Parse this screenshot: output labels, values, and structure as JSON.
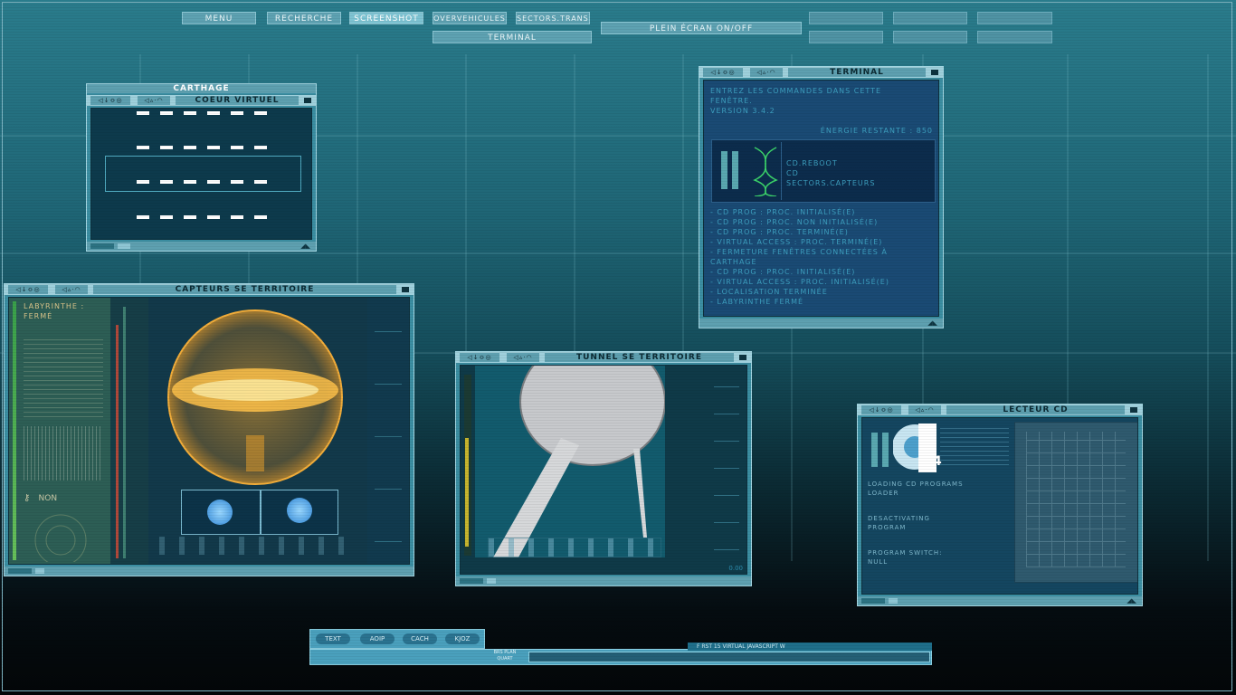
{
  "nav": {
    "menu": "MENU",
    "recherche": "RECHERCHE",
    "screenshot": "SCREENSHOT",
    "overvehicules": "OVERVEHICULES",
    "sectors": "SECTORS.TRANSP",
    "terminal": "TERMINAL",
    "fullscreen": "PLEIN ÉCRAN ON/OFF"
  },
  "carthage": {
    "title": "CARTHAGE",
    "subtitle": "COEUR VIRTUEL"
  },
  "capteurs": {
    "title": "CAPTEURS SE TERRITOIRE",
    "status_label": "LABYRINTHE :",
    "status_value": "FERMÉ",
    "key_label": "NON"
  },
  "tunnel": {
    "title": "TUNNEL SE TERRITOIRE",
    "counter": "0.00"
  },
  "terminal": {
    "title": "TERMINAL",
    "intro": [
      "ENTREZ LES COMMANDES DANS CETTE",
      "FENÊTRE.",
      "VERSION 3.4.2"
    ],
    "energy": "ÉNERGIE RESTANTE : 850",
    "commands": [
      "CD.REBOOT",
      "CD",
      "SECTORS.CAPTEURS"
    ],
    "log": [
      "- CD PROG : PROC. INITIALISÉ(E)",
      "- CD PROG : PROC. NON INITIALISÉ(E)",
      "- CD PROG : PROC. TERMINÉ(E)",
      "- VIRTUAL ACCESS : PROC. TERMINÉ(E)",
      "- FERMETURE FENÊTRES CONNECTÉES À",
      "CARTHAGE",
      "- CD PROG : PROC. INITIALISÉ(E)",
      "- VIRTUAL ACCESS : PROC. INITIALISÉ(E)",
      "- LOCALISATION TERMINÉE",
      "- LABYRINTHE FERMÉ"
    ]
  },
  "lecteur": {
    "title": "LECTEUR CD",
    "disc_number": "4",
    "lines": [
      "LOADING CD PROGRAMS",
      "LOADER",
      "DESACTIVATING",
      "PROGRAM",
      "PROGRAM SWITCH:",
      "NULL"
    ]
  },
  "dock": {
    "btn1": "TEXT",
    "btn2": "AOIP",
    "btn3": "CACH",
    "btn4": "KJOZ",
    "side_label": "BRS PLAN",
    "side_sub": "QUART",
    "ticker": "F   RST 15   VIRTUAL   JAVASCRIPT   W"
  },
  "colors": {
    "accent": "#5ea0b0",
    "title_bar": "#9fd0dc",
    "panel_dark": "#15475c",
    "text_blue": "#3d9fbf",
    "orange": "#f4a52a"
  }
}
